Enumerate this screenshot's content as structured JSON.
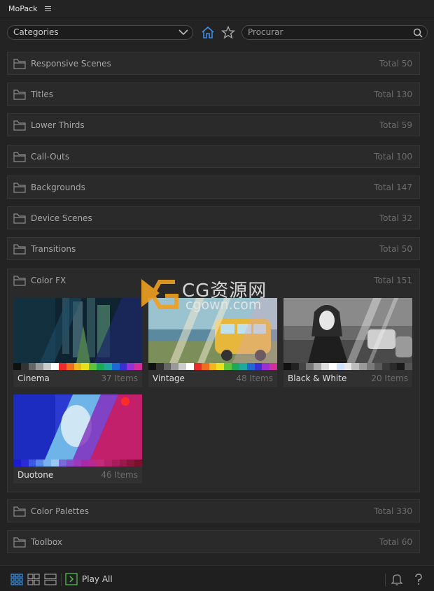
{
  "app": {
    "title": "MoPack"
  },
  "toolbar": {
    "category_select": "Categories",
    "search_placeholder": "Procurar"
  },
  "categories": [
    {
      "label": "Responsive Scenes",
      "total": "Total 50"
    },
    {
      "label": "Titles",
      "total": "Total 130"
    },
    {
      "label": "Lower Thirds",
      "total": "Total 59"
    },
    {
      "label": "Call-Outs",
      "total": "Total 100"
    },
    {
      "label": "Backgrounds",
      "total": "Total 147"
    },
    {
      "label": "Device Scenes",
      "total": "Total 32"
    },
    {
      "label": "Transitions",
      "total": "Total 50"
    }
  ],
  "color_fx": {
    "label": "Color FX",
    "total": "Total 151",
    "items": [
      {
        "name": "Cinema",
        "count": "37 Items"
      },
      {
        "name": "Vintage",
        "count": "48 Items"
      },
      {
        "name": "Black & White",
        "count": "20 Items"
      },
      {
        "name": "Duotone",
        "count": "46 Items"
      }
    ]
  },
  "categories_after": [
    {
      "label": "Color Palettes",
      "total": "Total 330"
    },
    {
      "label": "Toolbox",
      "total": "Total 60"
    }
  ],
  "bottom": {
    "play_all": "Play All"
  },
  "watermark": {
    "text": "CG资源网",
    "sub": "cgown.com"
  },
  "colors": {
    "accent": "#3a8ee6",
    "panel": "#2a2a2a",
    "background": "#232323"
  }
}
